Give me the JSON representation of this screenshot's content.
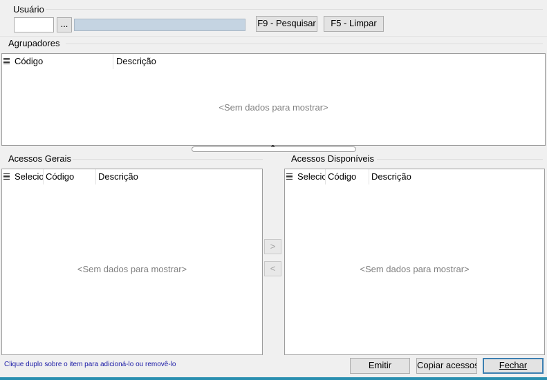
{
  "usuario": {
    "group_label": "Usuário",
    "code_value": "",
    "browse_label": "...",
    "name_value": "",
    "search_label": "F9 - Pesquisar",
    "clear_label": "F5 - Limpar"
  },
  "agrupadores": {
    "group_label": "Agrupadores",
    "columns": [
      "Código",
      "Descrição"
    ],
    "empty_text": "<Sem dados para mostrar>"
  },
  "splitter": {
    "icon": "chevron-up-icon",
    "glyph": "⌃"
  },
  "acessos_gerais": {
    "group_label": "Acessos Gerais",
    "columns": [
      "Selecionado",
      "Código",
      "Descrição"
    ],
    "empty_text": "<Sem dados para mostrar>"
  },
  "transfer": {
    "add_label": ">",
    "remove_label": "<"
  },
  "acessos_disponiveis": {
    "group_label": "Acessos Disponíveis",
    "columns": [
      "Selecionado",
      "Código",
      "Descrição"
    ],
    "empty_text": "<Sem dados para mostrar>"
  },
  "footer": {
    "hint": "Clique duplo sobre o item para adicioná-lo ou removê-lo",
    "emitir_label": "Emitir",
    "copiar_label": "Copiar acessos",
    "fechar_label": "Fechar"
  },
  "colors": {
    "accent": "#3c7fb1",
    "readonly_field": "#c5d4e2",
    "bottom_strip": "#2a8fb0"
  }
}
